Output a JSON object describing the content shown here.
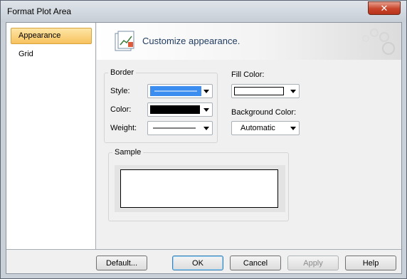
{
  "window": {
    "title": "Format Plot Area",
    "close_label": "✕"
  },
  "nav": {
    "items": [
      {
        "label": "Appearance",
        "selected": true
      },
      {
        "label": "Grid",
        "selected": false
      }
    ]
  },
  "header": {
    "text": "Customize appearance."
  },
  "border_group": {
    "legend": "Border",
    "style_label": "Style:",
    "color_label": "Color:",
    "weight_label": "Weight:",
    "style_swatch_color": "#3b8ef0",
    "color_swatch_color": "#000000"
  },
  "fill": {
    "label": "Fill Color:",
    "swatch_color": "#ffffff"
  },
  "background": {
    "label": "Background Color:",
    "value": "Automatic"
  },
  "sample": {
    "legend": "Sample"
  },
  "buttons": {
    "default": "Default...",
    "ok": "OK",
    "cancel": "Cancel",
    "apply": "Apply",
    "help": "Help"
  }
}
